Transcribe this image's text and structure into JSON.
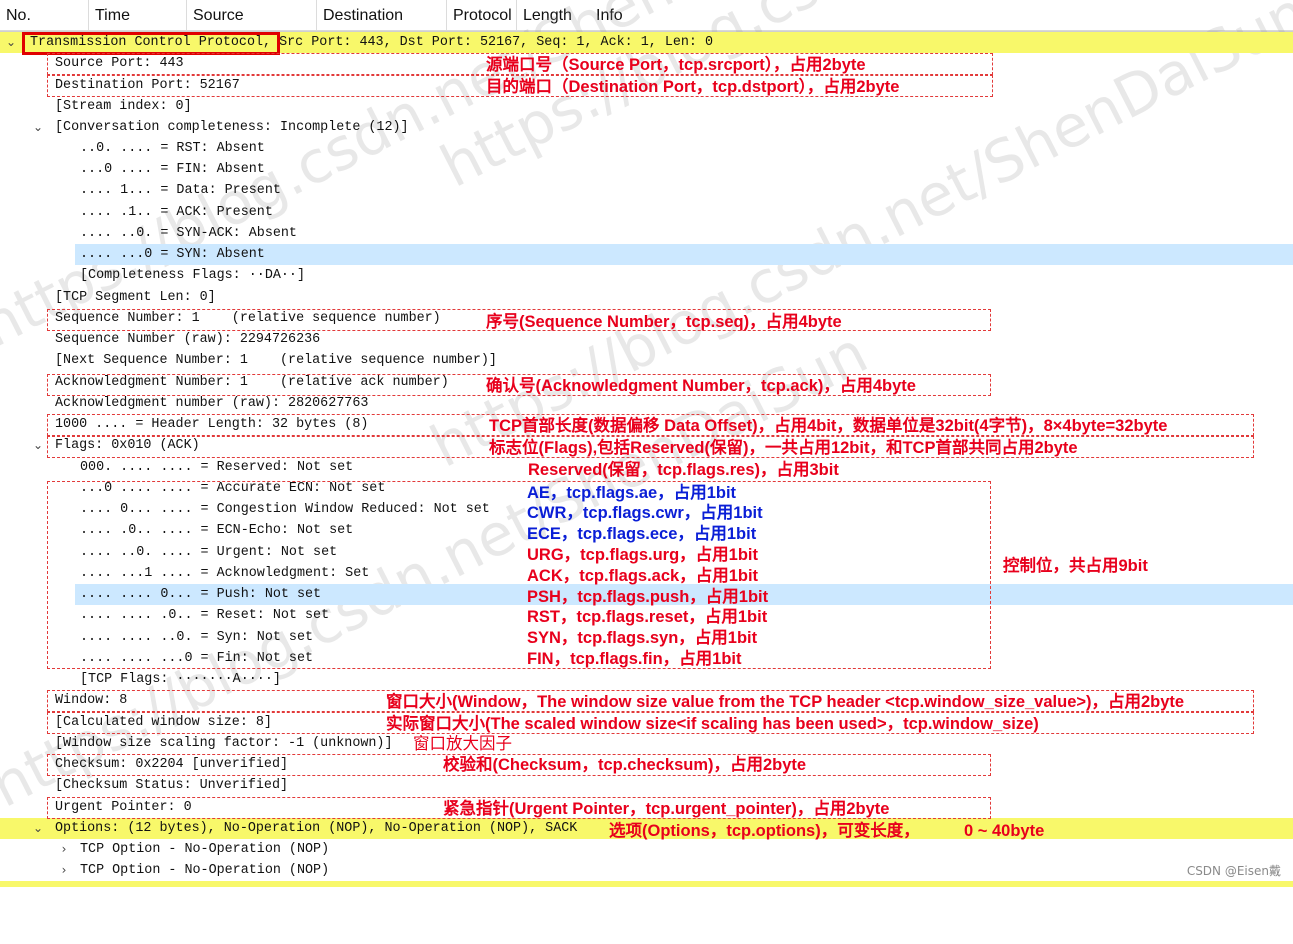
{
  "columns": [
    "No.",
    "Time",
    "Source",
    "Destination",
    "Protocol",
    "Length",
    "Info"
  ],
  "tree": [
    {
      "text": "Transmission Control Protocol, Src Port: 443, Dst Port: 52167, Seq: 1, Ack: 1, Len: 0",
      "chevron": "v"
    },
    {
      "text": "Source Port: 443"
    },
    {
      "text": "Destination Port: 52167"
    },
    {
      "text": "[Stream index: 0]"
    },
    {
      "text": "[Conversation completeness: Incomplete (12)]",
      "chevron": "v"
    },
    {
      "text": "..0. .... = RST: Absent"
    },
    {
      "text": "...0 .... = FIN: Absent"
    },
    {
      "text": ".... 1... = Data: Present"
    },
    {
      "text": ".... .1.. = ACK: Present"
    },
    {
      "text": ".... ..0. = SYN-ACK: Absent"
    },
    {
      "text": ".... ...0 = SYN: Absent"
    },
    {
      "text": "[Completeness Flags: ··DA··]"
    },
    {
      "text": "[TCP Segment Len: 0]"
    },
    {
      "text": "Sequence Number: 1    (relative sequence number)"
    },
    {
      "text": "Sequence Number (raw): 2294726236"
    },
    {
      "text": "[Next Sequence Number: 1    (relative sequence number)]"
    },
    {
      "text": "Acknowledgment Number: 1    (relative ack number)"
    },
    {
      "text": "Acknowledgment number (raw): 2820627763"
    },
    {
      "text": "1000 .... = Header Length: 32 bytes (8)"
    },
    {
      "text": "Flags: 0x010 (ACK)",
      "chevron": "v"
    },
    {
      "text": "000. .... .... = Reserved: Not set"
    },
    {
      "text": "...0 .... .... = Accurate ECN: Not set"
    },
    {
      "text": ".... 0... .... = Congestion Window Reduced: Not set"
    },
    {
      "text": ".... .0.. .... = ECN-Echo: Not set"
    },
    {
      "text": ".... ..0. .... = Urgent: Not set"
    },
    {
      "text": ".... ...1 .... = Acknowledgment: Set"
    },
    {
      "text": ".... .... 0... = Push: Not set"
    },
    {
      "text": ".... .... .0.. = Reset: Not set"
    },
    {
      "text": ".... .... ..0. = Syn: Not set"
    },
    {
      "text": ".... .... ...0 = Fin: Not set"
    },
    {
      "text": "[TCP Flags: ·······A····]"
    },
    {
      "text": "Window: 8"
    },
    {
      "text": "[Calculated window size: 8]"
    },
    {
      "text": "[Window size scaling factor: -1 (unknown)]"
    },
    {
      "text": "Checksum: 0x2204 [unverified]"
    },
    {
      "text": "[Checksum Status: Unverified]"
    },
    {
      "text": "Urgent Pointer: 0"
    },
    {
      "text": "Options: (12 bytes), No-Operation (NOP), No-Operation (NOP), SACK",
      "chevron": "v"
    },
    {
      "text": "TCP Option - No-Operation (NOP)",
      "chevron": ">"
    },
    {
      "text": "TCP Option - No-Operation (NOP)",
      "chevron": ">"
    }
  ],
  "annotations": [
    "源端口号（Source Port，tcp.srcport），占用2byte",
    "目的端口（Destination Port，tcp.dstport），占用2byte",
    "序号(Sequence Number，tcp.seq)，占用4byte",
    "确认号(Acknowledgment Number，tcp.ack)，占用4byte",
    "TCP首部长度(数据偏移 Data Offset)，占用4bit，数据单位是32bit(4字节)，8×4byte=32byte",
    "标志位(Flags),包括Reserved(保留)，一共占用12bit，和TCP首部共同占用2byte",
    "Reserved(保留，tcp.flags.res)，占用3bit",
    "AE，tcp.flags.ae，占用1bit",
    "CWR，tcp.flags.cwr，占用1bit",
    "ECE，tcp.flags.ece，占用1bit",
    "URG，tcp.flags.urg，占用1bit",
    "ACK，tcp.flags.ack，占用1bit",
    "PSH，tcp.flags.push，占用1bit",
    "RST，tcp.flags.reset，占用1bit",
    "SYN，tcp.flags.syn，占用1bit",
    "FIN，tcp.flags.fin，占用1bit",
    "控制位，共占用9bit",
    "窗口大小(Window，The window size value from the TCP header <tcp.window_size_value>)，占用2byte",
    "实际窗口大小(The scaled window size<if scaling has been used>，tcp.window_size)",
    "窗口放大因子",
    "校验和(Checksum，tcp.checksum)，占用2byte",
    "紧急指针(Urgent Pointer，tcp.urgent_pointer)，占用2byte",
    "选项(Options，tcp.options)，可变长度，",
    "0 ~ 40byte"
  ],
  "watermarks": [
    "https://blog.csdn.net/ShenDaiSun",
    "https://blog.csdn.net/ShenDaiSun",
    "https://blog.csdn.net/ShenDaiSun",
    "https://blog.csdn.net/ShenDaiSun"
  ],
  "credit": "CSDN @Eisen戴",
  "colors": {
    "yellow_row": "#f8f86a",
    "selected_row": "#cce8ff",
    "annotation_red": "#e8001c",
    "annotation_blue": "#0a1ed6",
    "box_red": "#e23a3a"
  }
}
